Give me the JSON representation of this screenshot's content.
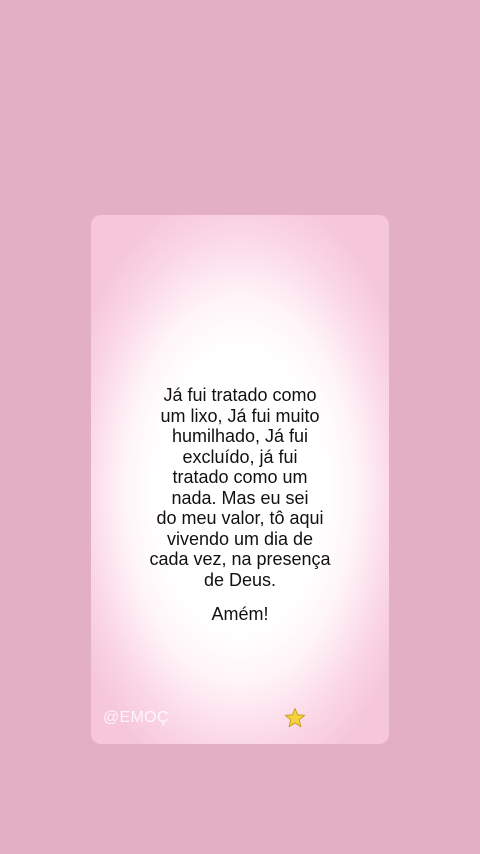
{
  "card": {
    "quote": "Já fui tratado como\num lixo, Já fui muito\nhumilhado, Já fui\nexcluído, já fui\ntratado como um\nnada. Mas eu sei\ndo meu valor, tô aqui\nvivendo um dia de\ncada vez, na presença\nde Deus.",
    "amen": "Amém!",
    "handle": "@EMOÇ",
    "star_icon": "star-icon"
  },
  "colors": {
    "background": "#e3b0c3",
    "star": "#f4d23c",
    "text": "#111111"
  }
}
